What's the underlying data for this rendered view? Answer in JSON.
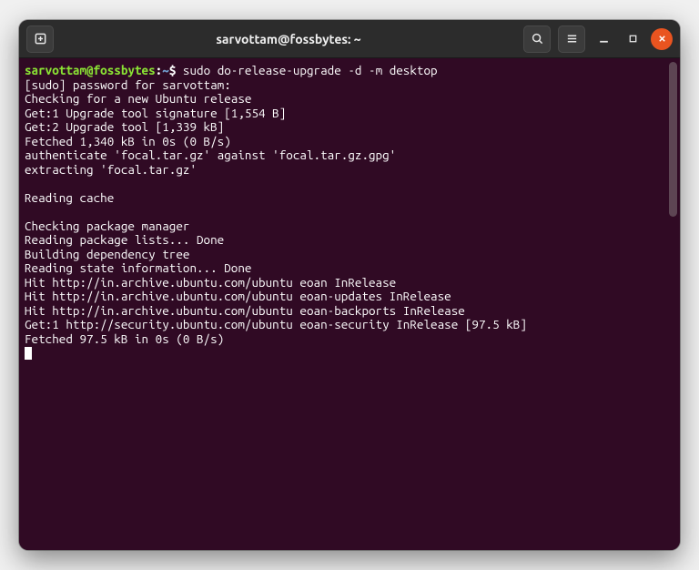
{
  "titlebar": {
    "title": "sarvottam@fossbytes: ~"
  },
  "prompt": {
    "user_host": "sarvottam@fossbytes",
    "separator": ":",
    "path": "~",
    "symbol": "$",
    "command": "sudo do-release-upgrade -d -m desktop"
  },
  "output_lines": [
    "[sudo] password for sarvottam:",
    "Checking for a new Ubuntu release",
    "Get:1 Upgrade tool signature [1,554 B]",
    "Get:2 Upgrade tool [1,339 kB]",
    "Fetched 1,340 kB in 0s (0 B/s)",
    "authenticate 'focal.tar.gz' against 'focal.tar.gz.gpg'",
    "extracting 'focal.tar.gz'",
    "",
    "Reading cache",
    "",
    "Checking package manager",
    "Reading package lists... Done",
    "Building dependency tree",
    "Reading state information... Done",
    "Hit http://in.archive.ubuntu.com/ubuntu eoan InRelease",
    "Hit http://in.archive.ubuntu.com/ubuntu eoan-updates InRelease",
    "Hit http://in.archive.ubuntu.com/ubuntu eoan-backports InRelease",
    "Get:1 http://security.ubuntu.com/ubuntu eoan-security InRelease [97.5 kB]",
    "Fetched 97.5 kB in 0s (0 B/s)"
  ]
}
